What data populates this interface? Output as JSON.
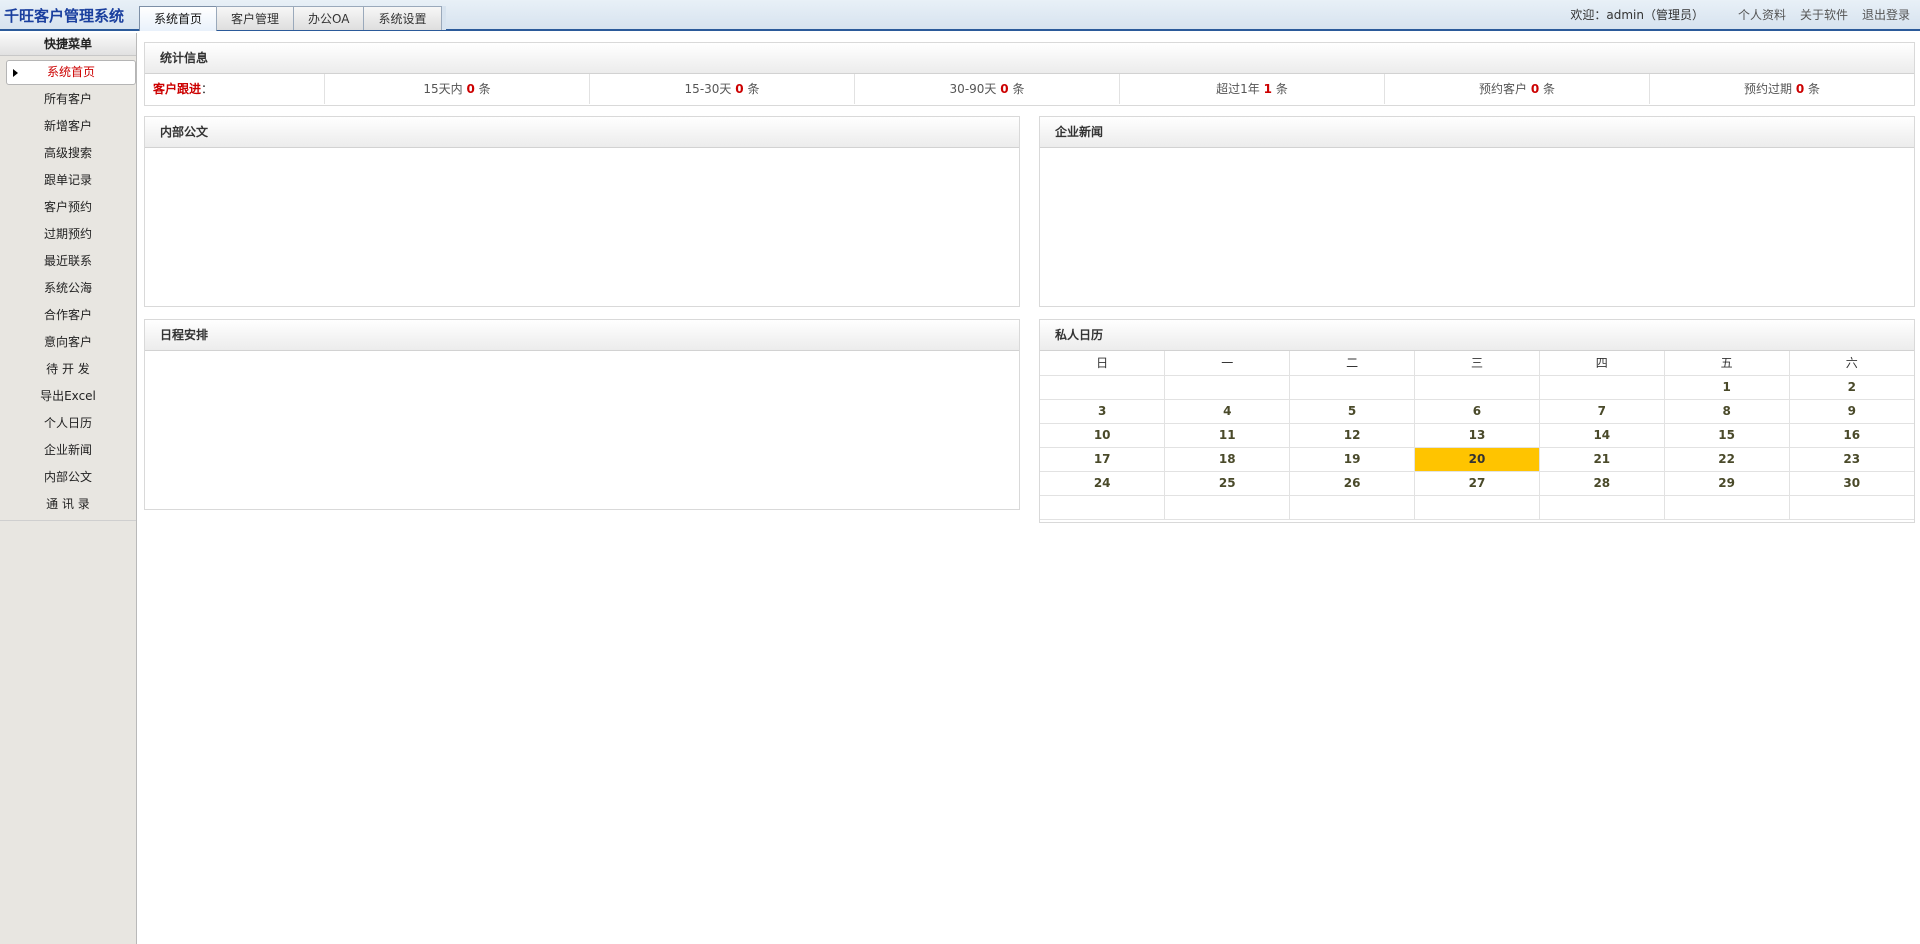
{
  "app": {
    "title": "千旺客户管理系统"
  },
  "tabs": [
    {
      "label": "系统首页",
      "active": true
    },
    {
      "label": "客户管理",
      "active": false
    },
    {
      "label": "办公OA",
      "active": false
    },
    {
      "label": "系统设置",
      "active": false
    }
  ],
  "header": {
    "welcome": "欢迎：admin（管理员）",
    "profile": "个人资料",
    "about": "关于软件",
    "logout": "退出登录"
  },
  "sidebar": {
    "title": "快捷菜单",
    "items": [
      {
        "label": "系统首页",
        "active": true
      },
      {
        "label": "所有客户"
      },
      {
        "label": "新增客户"
      },
      {
        "label": "高级搜索"
      },
      {
        "label": "跟单记录"
      },
      {
        "label": "客户预约"
      },
      {
        "label": "过期预约"
      },
      {
        "label": "最近联系"
      },
      {
        "label": "系统公海"
      },
      {
        "label": "合作客户"
      },
      {
        "label": "意向客户"
      },
      {
        "label": "待 开 发"
      },
      {
        "label": "导出Excel"
      },
      {
        "label": "个人日历"
      },
      {
        "label": "企业新闻"
      },
      {
        "label": "内部公文"
      },
      {
        "label": "通 讯 录"
      }
    ]
  },
  "stats": {
    "title": "统计信息",
    "label": "客户跟进",
    "label_colon": "：",
    "unit": "条",
    "cells": [
      {
        "prefix": "15天内",
        "count": "0"
      },
      {
        "prefix": "15-30天",
        "count": "0"
      },
      {
        "prefix": "30-90天",
        "count": "0"
      },
      {
        "prefix": "超过1年",
        "count": "1"
      },
      {
        "prefix": "预约客户",
        "count": "0"
      },
      {
        "prefix": "预约过期",
        "count": "0"
      }
    ]
  },
  "panels": {
    "internal_docs": "内部公文",
    "company_news": "企业新闻",
    "schedule": "日程安排",
    "calendar": "私人日历"
  },
  "calendar": {
    "weekdays": [
      "日",
      "一",
      "二",
      "三",
      "四",
      "五",
      "六"
    ],
    "weeks": [
      [
        "",
        "",
        "",
        "",
        "",
        "1",
        "2"
      ],
      [
        "3",
        "4",
        "5",
        "6",
        "7",
        "8",
        "9"
      ],
      [
        "10",
        "11",
        "12",
        "13",
        "14",
        "15",
        "16"
      ],
      [
        "17",
        "18",
        "19",
        "20",
        "21",
        "22",
        "23"
      ],
      [
        "24",
        "25",
        "26",
        "27",
        "28",
        "29",
        "30"
      ],
      [
        "",
        "",
        "",
        "",
        "",
        "",
        ""
      ]
    ],
    "today": "20",
    "today_color": "#ffc400"
  },
  "colors": {
    "brand": "#1a3f9e",
    "accent_red": "#cc0000",
    "topbar_border": "#2b5a9a"
  }
}
